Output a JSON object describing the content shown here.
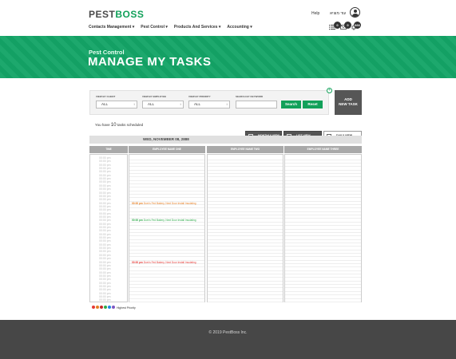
{
  "brand": {
    "logo_prefix": "PEST",
    "logo_suffix": "BOSS",
    "green": "#12a15a",
    "banner_green": "#14a567"
  },
  "header": {
    "help": "Help",
    "username": "עוד מוציא",
    "badges": [
      "0",
      "0",
      "666"
    ],
    "nav": [
      "Contacts Management ▾",
      "Pest Control ▾",
      "Products And Services ▾",
      "Accounting ▾"
    ]
  },
  "banner": {
    "subtitle": "Pest Control",
    "title": "MANAGE MY TASKS"
  },
  "filters": {
    "client_label": "VIEW BY CLIENT",
    "employee_label": "VIEW BY EMPLOYEE",
    "priority_label": "VIEW BY PRIORITY",
    "keyword_label": "SEARCH BY KEYWORD",
    "client_value": "ALL",
    "employee_value": "ALL",
    "priority_value": "ALL",
    "search_label": "Search",
    "reset_label": "Reset",
    "plus": "+"
  },
  "add_task": {
    "line1": "ADD",
    "line2": "NEW TASK"
  },
  "summary": {
    "prefix": "You have",
    "count": "10",
    "suffix": "tasks scheduled"
  },
  "views": {
    "monthly": "MONTHLY VIEW",
    "list": "LIST VIEW",
    "daily": "DAILY VIEW"
  },
  "calendar": {
    "date": "WED, NOVEMBER 08, 2888",
    "columns": [
      "TIME",
      "EMPLOYEE NAME ONE",
      "EMPLOYEE NAME TWO",
      "EMPLOYEE NAME THREE"
    ],
    "time_slots": [
      "00:00 pm",
      "00:00 pm",
      "00:00 pm",
      "00:00 pm",
      "00:00 pm",
      "00:00 pm",
      "00:00 pm",
      "00:00 pm",
      "00:00 pm",
      "00:00 pm",
      "00:00 pm",
      "00:00 pm",
      "00:00 pm",
      "00:00 pm",
      "00:00 pm",
      "00:00 pm",
      "00:00 pm",
      "00:00 pm",
      "00:00 pm",
      "00:00 pm",
      "00:00 pm",
      "00:00 pm",
      "00:00 pm",
      "00:00 pm",
      "00:00 pm",
      "00:00 pm",
      "00:00 pm",
      "00:00 pm",
      "00:00 pm",
      "00:00 pm",
      "00:00 pm",
      "00:00 pm",
      "00:00 pm",
      "00:00 pm",
      "00:00 pm",
      "00:00 pm",
      "00:00 pm",
      "00:00 pm",
      "00:00 pm",
      "00:00 pm",
      "00:00 pm",
      "00:00 pm"
    ],
    "tasks": [
      {
        "time": "00:00 pm",
        "text": "Dom’s Fed Bakery, Next Door Install Insulating",
        "color": "#e67e22"
      },
      {
        "time": "00:00 pm",
        "text": "Dom’s Fed Bakery, Next Door Install Insulating",
        "color": "#2eaa4a"
      },
      {
        "time": "00:00 pm",
        "text": "Dom’s Fed Bakery, Next Door Install Insulating",
        "color": "#e53935"
      }
    ]
  },
  "legend": {
    "colors": [
      "#e53935",
      "#e67e22",
      "#c62828",
      "#2eaa4a",
      "#1e88e5",
      "#7e57c2"
    ],
    "label": "Highest Priority"
  },
  "footer": {
    "copyright": "© 2019 PestBoss Inc."
  }
}
